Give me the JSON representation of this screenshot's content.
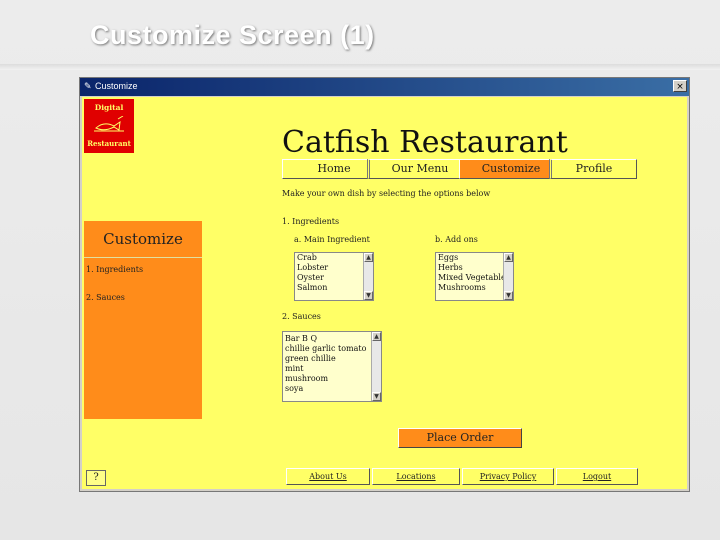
{
  "slide": {
    "title": "Customize Screen (1)"
  },
  "window": {
    "title": "Customize",
    "close_glyph": "×"
  },
  "logo": {
    "line1": "Digital",
    "line2": "Restaurant"
  },
  "header": {
    "restaurant_name": "Catfish Restaurant"
  },
  "nav": {
    "home": "Home",
    "our_menu": "Our Menu",
    "customize": "Customize",
    "profile": "Profile"
  },
  "instruction": "Make your own dish by selecting the options below",
  "sidebar": {
    "heading": "Customize",
    "item1": "1. Ingredients",
    "item2": "2. Sauces"
  },
  "ingredients": {
    "section_label": "1. Ingredients",
    "main_label": "a. Main Ingredient",
    "main_options": [
      "Crab",
      "Lobster",
      "Oyster",
      "Salmon"
    ],
    "addon_label": "b. Add ons",
    "addon_options": [
      "Eggs",
      "Herbs",
      "Mixed Vegetables",
      "Mushrooms"
    ]
  },
  "sauces": {
    "section_label": "2. Sauces",
    "options": [
      "Bar B Q",
      "chillie garlic tomato",
      "green chillie",
      "mint",
      "mushroom",
      "soya"
    ]
  },
  "order_button": "Place Order",
  "help_glyph": "?",
  "footer": {
    "about": "About Us",
    "locations": "Locations",
    "privacy": "Privacy Policy",
    "logout": "Logout"
  },
  "colors": {
    "yellow": "#ffff66",
    "orange": "#ff8c1a",
    "logo_red": "#e00000"
  }
}
